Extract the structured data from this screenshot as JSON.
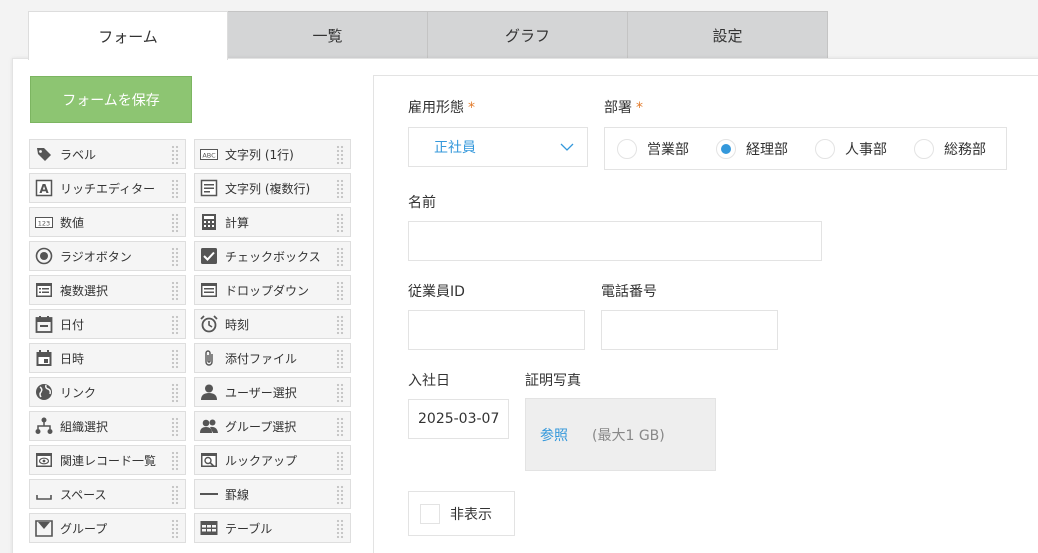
{
  "tabs": [
    {
      "label": "フォーム",
      "active": true
    },
    {
      "label": "一覧",
      "active": false
    },
    {
      "label": "グラフ",
      "active": false
    },
    {
      "label": "設定",
      "active": false
    }
  ],
  "save_button": "フォームを保存",
  "palette": [
    {
      "label": "ラベル",
      "icon": "tag-icon"
    },
    {
      "label": "文字列 (1行)",
      "icon": "abc-icon"
    },
    {
      "label": "リッチエディター",
      "icon": "rich-text-icon"
    },
    {
      "label": "文字列 (複数行)",
      "icon": "multiline-text-icon"
    },
    {
      "label": "数値",
      "icon": "number-icon"
    },
    {
      "label": "計算",
      "icon": "calculator-icon"
    },
    {
      "label": "ラジオボタン",
      "icon": "radio-button-icon"
    },
    {
      "label": "チェックボックス",
      "icon": "checkbox-icon"
    },
    {
      "label": "複数選択",
      "icon": "multi-select-icon"
    },
    {
      "label": "ドロップダウン",
      "icon": "dropdown-icon"
    },
    {
      "label": "日付",
      "icon": "calendar-icon"
    },
    {
      "label": "時刻",
      "icon": "alarm-clock-icon"
    },
    {
      "label": "日時",
      "icon": "datetime-icon"
    },
    {
      "label": "添付ファイル",
      "icon": "paperclip-icon"
    },
    {
      "label": "リンク",
      "icon": "globe-icon"
    },
    {
      "label": "ユーザー選択",
      "icon": "user-icon"
    },
    {
      "label": "組織選択",
      "icon": "org-chart-icon"
    },
    {
      "label": "グループ選択",
      "icon": "group-icon"
    },
    {
      "label": "関連レコード一覧",
      "icon": "eye-list-icon"
    },
    {
      "label": "ルックアップ",
      "icon": "lookup-icon"
    },
    {
      "label": "スペース",
      "icon": "space-icon"
    },
    {
      "label": "罫線",
      "icon": "line-icon"
    },
    {
      "label": "グループ",
      "icon": "group-field-icon"
    },
    {
      "label": "テーブル",
      "icon": "table-icon"
    }
  ],
  "form": {
    "employment_type": {
      "label": "雇用形態",
      "required_mark": "*",
      "value": "正社員"
    },
    "department": {
      "label": "部署",
      "required_mark": "*",
      "options": [
        {
          "label": "営業部",
          "selected": false
        },
        {
          "label": "経理部",
          "selected": true
        },
        {
          "label": "人事部",
          "selected": false
        },
        {
          "label": "総務部",
          "selected": false
        }
      ]
    },
    "name": {
      "label": "名前",
      "value": ""
    },
    "employee_id": {
      "label": "従業員ID",
      "value": ""
    },
    "phone": {
      "label": "電話番号",
      "value": ""
    },
    "hire_date": {
      "label": "入社日",
      "value": "2025-03-07"
    },
    "photo": {
      "label": "証明写真",
      "browse": "参照",
      "max": "(最大1 GB)"
    },
    "hidden": {
      "label": "非表示"
    }
  },
  "colors": {
    "accent": "#3498db",
    "save": "#8dc572",
    "required": "#e27b2b"
  }
}
